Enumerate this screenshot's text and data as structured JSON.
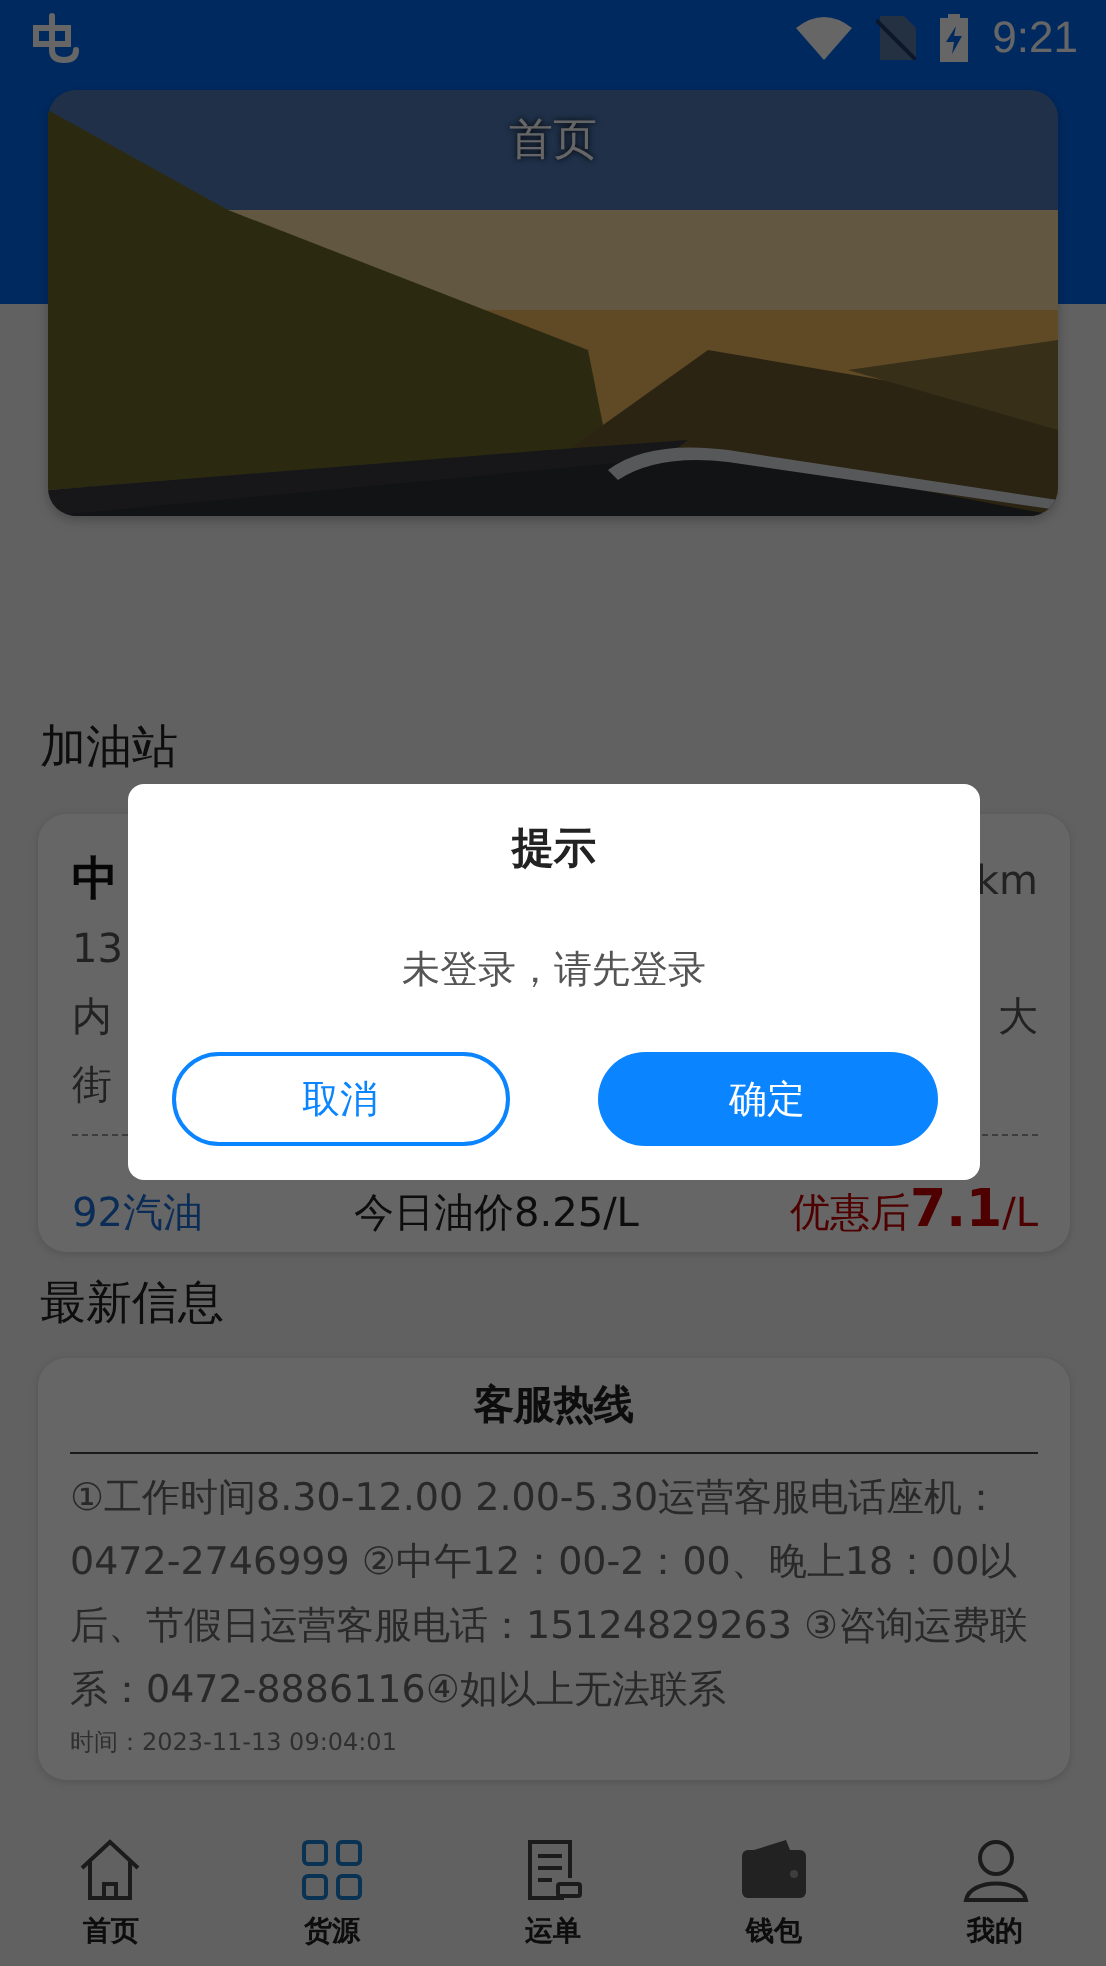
{
  "status_bar": {
    "time": "9:21"
  },
  "header": {
    "title": "首页"
  },
  "gas_section": {
    "title": "加油站",
    "station": {
      "name": "中",
      "distance": "km",
      "phone": "13",
      "address_start": "内",
      "address_end": "大",
      "address_line2": "街",
      "fuel": "92汽油",
      "today_price": "今日油价8.25/L",
      "discount_price": "优惠后**7.1**/L"
    }
  },
  "news_section": {
    "title": "最新信息",
    "notice": {
      "title": "客服热线",
      "body": "①工作时间8.30-12.00 2.00-5.30运营客服电话座机：0472-2746999 ②中午12：00-2：00、晚上18：00以后、节假日运营客服电话：15124829263 ③咨询运费联系：0472-8886116④如以上无法联系",
      "time": "时间：2023-11-13 09:04:01"
    }
  },
  "tab_bar": [
    {
      "label": "首页",
      "selected": false
    },
    {
      "label": "货源",
      "selected": true
    },
    {
      "label": "运单",
      "selected": false
    },
    {
      "label": "钱包",
      "selected": false
    },
    {
      "label": "我的",
      "selected": false
    }
  ],
  "dialog": {
    "title": "提示",
    "message": "未登录，请先登录",
    "buttons": [
      {
        "label": "取消",
        "kind": "secondary"
      },
      {
        "label": "确定",
        "kind": "primary"
      }
    ]
  }
}
